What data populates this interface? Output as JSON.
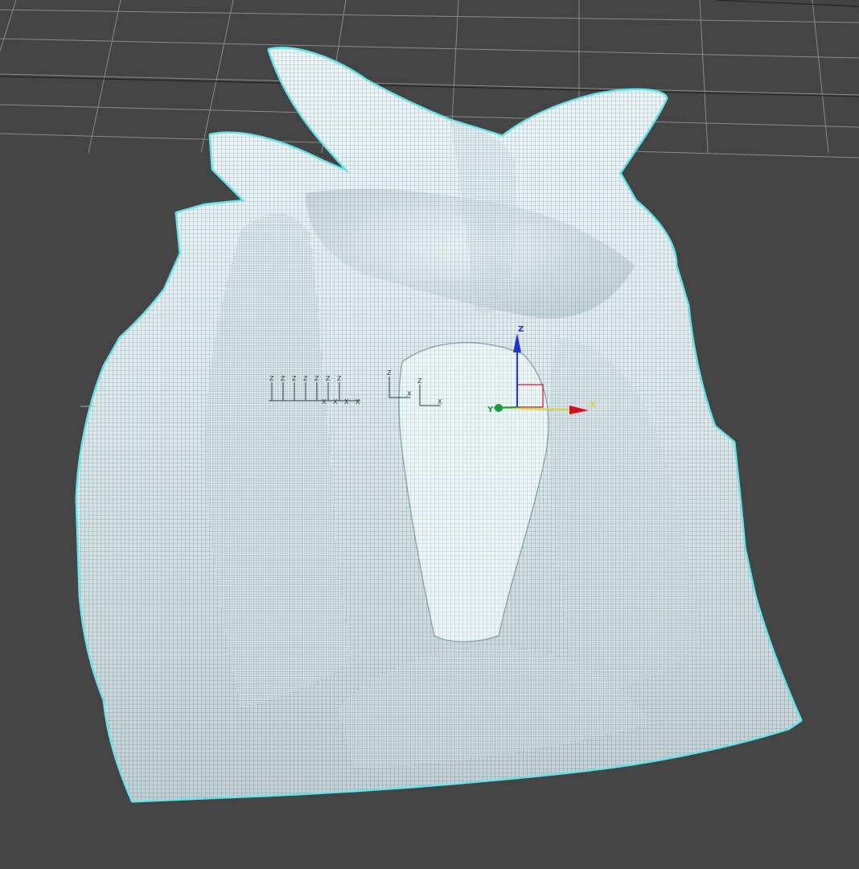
{
  "viewport": {
    "background_color": "#444444",
    "grid_color": "#8a8a8a",
    "grid_axis_color": "#1e1e1e",
    "selection_outline_color": "#62e4ee",
    "mesh_fill_color": "#e8f4f6",
    "mesh_wire_color": "#2f4a55"
  },
  "gizmo": {
    "x_label": "X",
    "y_label": "Y",
    "z_label": "Z",
    "x_color": "#d6101b",
    "y_color": "#d8d820",
    "z_color": "#1c33d6",
    "pivot_color": "#1a9a3a"
  },
  "helpers": {
    "group_a_labels": [
      "Z",
      "Z",
      "Z",
      "Z",
      "Z",
      "Z",
      "Z"
    ],
    "group_a_x_labels": [
      "X",
      "X",
      "X",
      "X"
    ],
    "group_b_z_labels": [
      "Z",
      "Z"
    ],
    "group_b_x_labels": [
      "X",
      "X"
    ]
  }
}
